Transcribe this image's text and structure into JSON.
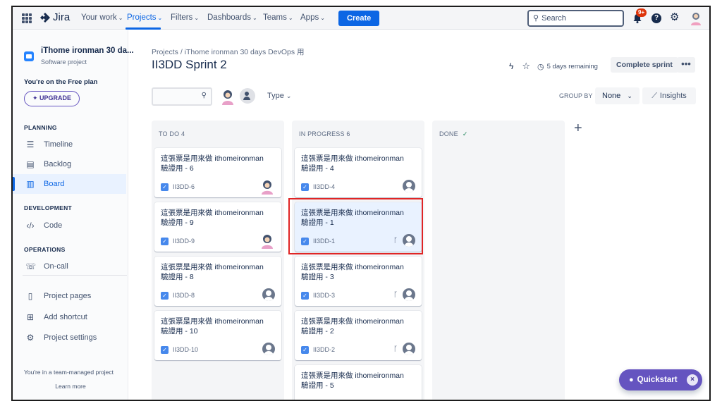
{
  "topnav": {
    "logo": "Jira",
    "items": [
      {
        "label": "Your work",
        "chev": "⌄"
      },
      {
        "label": "Projects",
        "chev": "⌄"
      },
      {
        "label": "Filters",
        "chev": "⌄"
      },
      {
        "label": "Dashboards",
        "chev": "⌄"
      },
      {
        "label": "Teams",
        "chev": "⌄"
      },
      {
        "label": "Apps",
        "chev": "⌄"
      }
    ],
    "create_label": "Create",
    "search_placeholder": "Search",
    "notification_count": "9+",
    "help_label": "?"
  },
  "sidebar": {
    "project_name": "iThome ironman 30 da...",
    "project_type": "Software project",
    "plan_note": "You're on the Free plan",
    "upgrade_label": "✦ UPGRADE",
    "planning_head": "PLANNING",
    "development_head": "DEVELOPMENT",
    "operations_head": "OPERATIONS",
    "items": {
      "timeline": "Timeline",
      "backlog": "Backlog",
      "board": "Board",
      "code": "Code",
      "oncall": "On-call",
      "project_pages": "Project pages",
      "add_shortcut": "Add shortcut",
      "project_settings": "Project settings"
    },
    "team_note": "You're in a team-managed project",
    "learn_more": "Learn more"
  },
  "main": {
    "breadcrumb": "Projects  /  iThome ironman 30 days DevOps 用",
    "title": "II3DD Sprint 2",
    "days_remaining": "5 days remaining",
    "complete_sprint": "Complete sprint",
    "more": "•••",
    "type_filter": "Type",
    "group_by_label": "GROUP BY",
    "group_by_value": "None",
    "insights": "Insights"
  },
  "columns": [
    {
      "header": "TO DO 4",
      "cards": [
        {
          "title": "這張票是用來做 ithomeironman 驗證用 - 6",
          "key": "II3DD-6",
          "assignee": "avatar",
          "branch": false
        },
        {
          "title": "這張票是用來做 ithomeironman 驗證用 - 9",
          "key": "II3DD-9",
          "assignee": "avatar",
          "branch": false
        },
        {
          "title": "這張票是用來做 ithomeironman 驗證用 - 8",
          "key": "II3DD-8",
          "assignee": "unassigned",
          "branch": false
        },
        {
          "title": "這張票是用來做 ithomeironman 驗證用 - 10",
          "key": "II3DD-10",
          "assignee": "unassigned",
          "branch": false
        }
      ]
    },
    {
      "header": "IN PROGRESS 6",
      "cards": [
        {
          "title": "這張票是用來做 ithomeironman 驗證用 - 4",
          "key": "II3DD-4",
          "assignee": "unassigned",
          "branch": false
        },
        {
          "title": "這張票是用來做 ithomeironman 驗證用 - 1",
          "key": "II3DD-1",
          "assignee": "unassigned",
          "branch": true,
          "selected": true
        },
        {
          "title": "這張票是用來做 ithomeironman 驗證用 - 3",
          "key": "II3DD-3",
          "assignee": "unassigned",
          "branch": true
        },
        {
          "title": "這張票是用來做 ithomeironman 驗證用 - 2",
          "key": "II3DD-2",
          "assignee": "unassigned",
          "branch": true
        },
        {
          "title": "這張票是用來做 ithomeironman 驗證用 - 5",
          "key": "",
          "assignee": "unassigned",
          "branch": false
        }
      ]
    },
    {
      "header": "DONE",
      "done_check": "✓",
      "cards": []
    }
  ],
  "quickstart": {
    "label": "Quickstart",
    "close": "×"
  },
  "colors": {
    "brand_blue": "#0c66e4",
    "quickstart_purple": "#6554c0",
    "highlight_red": "#e02525",
    "notification_red": "#de350b"
  }
}
